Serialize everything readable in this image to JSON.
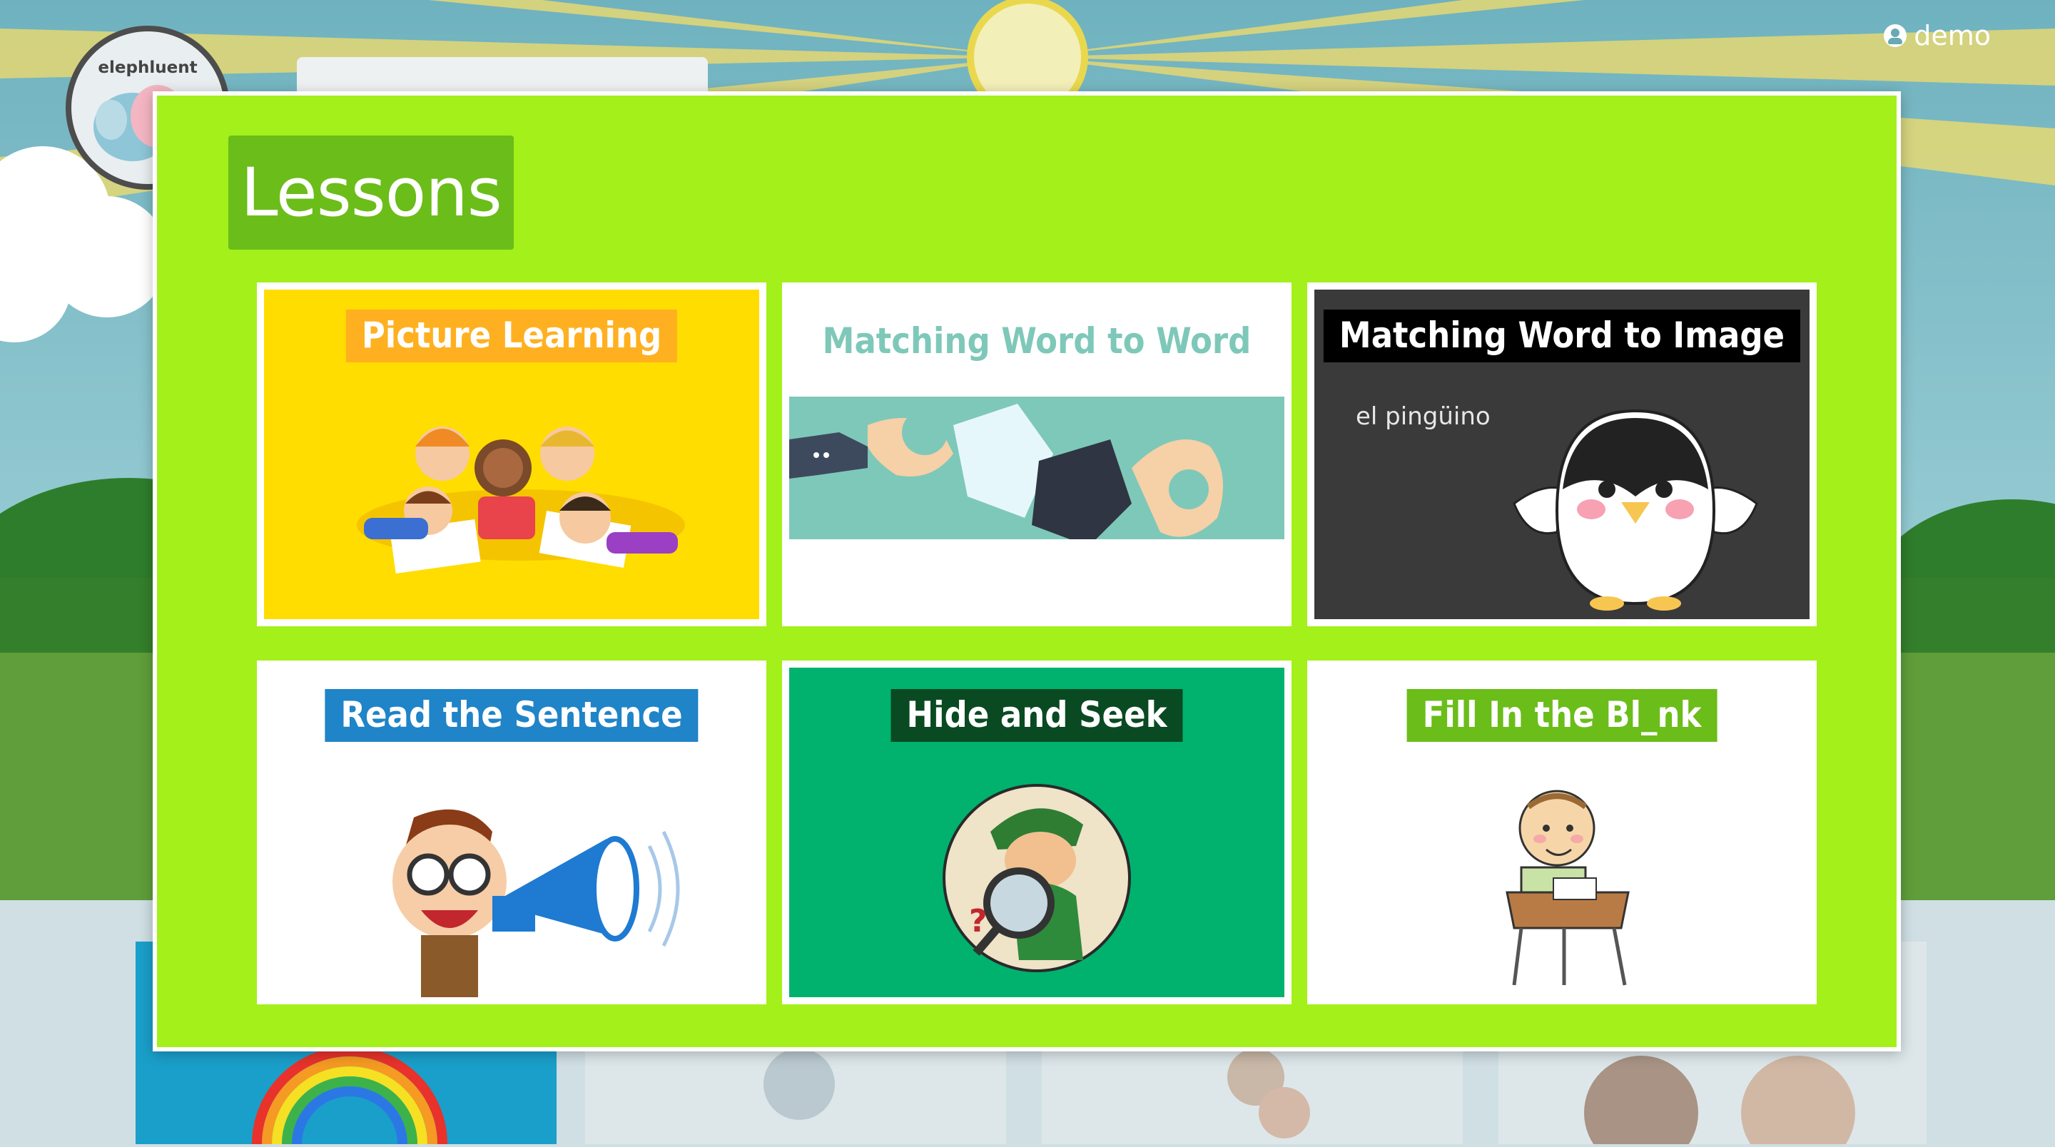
{
  "app": {
    "logo_text": "elephluent",
    "user_name": "demo"
  },
  "colors": {
    "modal_bg": "#a3f01b",
    "title_bg": "#6bbd19",
    "picture_learning_bg": "#ffdd00",
    "picture_learning_label_bg": "#ffb020",
    "matching_word_label": "#7ec8b9",
    "matching_image_bg": "#3a3a3a",
    "read_sentence_label_bg": "#1f84c8",
    "hide_seek_bg": "#00b26e",
    "hide_seek_label_bg": "#0a4a22",
    "fill_blank_label_bg": "#6bbd19"
  },
  "modal": {
    "title": "Lessons",
    "cards": [
      {
        "label": "Picture Learning",
        "icon": "children-drawing-image"
      },
      {
        "label": "Matching Word to Word",
        "icon": "puzzle-hands-image"
      },
      {
        "label": "Matching Word to Image",
        "caption": "el pingüino",
        "icon": "penguin-image"
      },
      {
        "label": "Read the Sentence",
        "icon": "megaphone-boy-image"
      },
      {
        "label": "Hide and Seek",
        "icon": "detective-image"
      },
      {
        "label": "Fill In the Bl_nk",
        "icon": "boy-at-desk-image"
      }
    ]
  }
}
